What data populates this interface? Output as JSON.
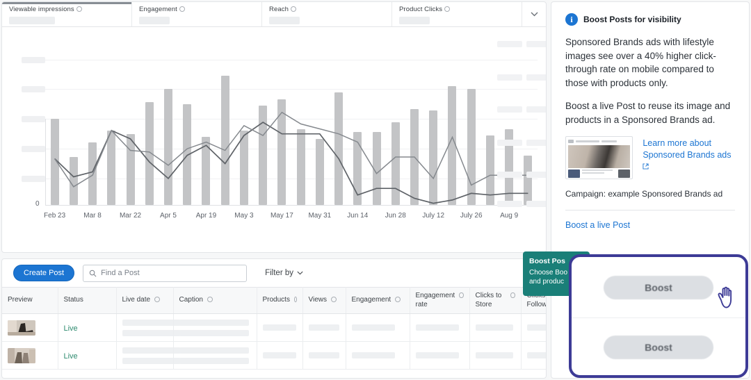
{
  "metric_tabs": [
    {
      "label": "Viewable impressions",
      "icon": "info-icon",
      "value_placeholder": "loading-skeleton"
    },
    {
      "label": "Engagement",
      "icon": "info-icon",
      "value_placeholder": "loading-skeleton"
    },
    {
      "label": "Reach",
      "icon": "info-icon",
      "value_placeholder": "loading-skeleton"
    },
    {
      "label": "Product Clicks",
      "icon": "info-icon",
      "value_placeholder": "loading-skeleton"
    }
  ],
  "tabs_caret_icon": "chevron-down-icon",
  "chart_data": {
    "type": "bar",
    "title": "",
    "xlabel": "",
    "ylabel": "",
    "ylim": [
      0,
      100
    ],
    "grid": true,
    "legend": "none",
    "y_zero_label": "0",
    "y_tick_labels": [
      "",
      "",
      "",
      "",
      ""
    ],
    "categories": [
      "Feb 23",
      "",
      "Mar 8",
      "",
      "Mar 22",
      "",
      "Apr 5",
      "",
      "Apr 19",
      "",
      "May 3",
      "",
      "May 17",
      "",
      "May 31",
      "",
      "Jun 14",
      "",
      "Jun 28",
      "",
      "July 12",
      "",
      "July 26",
      "",
      "Aug 9",
      ""
    ],
    "tick_labels": [
      "Feb 23",
      "Mar 8",
      "Mar 22",
      "Apr 5",
      "Apr 19",
      "May 3",
      "May 17",
      "May 31",
      "Jun 14",
      "Jun 28",
      "July 12",
      "July 26",
      "Aug 9"
    ],
    "values": [
      52,
      29,
      38,
      45,
      43,
      62,
      70,
      61,
      41,
      78,
      45,
      60,
      64,
      46,
      40,
      68,
      44,
      44,
      50,
      58,
      57,
      72,
      70,
      42,
      46,
      30
    ],
    "series": [
      {
        "name": "line-series-1",
        "type": "line",
        "values": [
          28,
          17,
          20,
          45,
          40,
          26,
          16,
          30,
          36,
          25,
          42,
          50,
          43,
          43,
          43,
          28,
          6,
          10,
          10,
          4,
          1,
          3,
          7,
          6,
          7,
          7
        ]
      },
      {
        "name": "line-series-2",
        "type": "line",
        "values": [
          28,
          11,
          18,
          45,
          33,
          32,
          24,
          34,
          38,
          33,
          48,
          42,
          56,
          49,
          46,
          43,
          38,
          19,
          29,
          29,
          16,
          41,
          12,
          18,
          18,
          18
        ]
      }
    ]
  },
  "toolbar": {
    "create_post_label": "Create Post",
    "search_icon": "search-icon",
    "search_placeholder": "Find a Post",
    "search_value": "",
    "filter_label": "Filter by",
    "filter_caret_icon": "chevron-down-icon"
  },
  "table": {
    "columns": [
      {
        "label": "Preview",
        "info": false
      },
      {
        "label": "Status",
        "info": false
      },
      {
        "label": "Live date",
        "info": true
      },
      {
        "label": "Caption",
        "info": true
      },
      {
        "label": "Products",
        "info": true
      },
      {
        "label": "Views",
        "info": true
      },
      {
        "label": "Engagement",
        "info": true
      },
      {
        "label": "Engagement rate",
        "info": true
      },
      {
        "label": "Clicks to Store",
        "info": true
      },
      {
        "label": "Clicks to Follow",
        "info": true
      }
    ],
    "rows": [
      {
        "preview": "post-thumbnail-1",
        "status": "Live"
      },
      {
        "preview": "post-thumbnail-2",
        "status": "Live"
      }
    ]
  },
  "right_panel": {
    "icon": "info-circle-icon",
    "title": "Boost Posts for visibility",
    "paragraph_1": "Sponsored Brands ads with lifestyle images see over a 40% higher click-through rate on mobile compared to those with products only.",
    "paragraph_2": "Boost a live Post to reuse its image and products in a Sponsored Brands ad.",
    "ad_preview_name": "sponsored-brands-ad-preview",
    "learn_more_line_1": "Learn more about",
    "learn_more_line_2": "Sponsored Brands ads",
    "external_link_icon": "external-link-icon",
    "campaign_caption": "Campaign: example Sponsored Brands ad",
    "boost_live_post_link": "Boost a live Post"
  },
  "teal_tooltip": {
    "title": "Boost Pos",
    "body_line_1": "Choose Boo",
    "body_line_2": "and produc"
  },
  "highlight": {
    "border_color": "#3d3b96",
    "boost_button_label": "Boost",
    "cursor_icon": "pointer-hand-cursor"
  },
  "colors": {
    "accent_blue": "#1c75d2",
    "status_green": "#2e8b6f",
    "tooltip_teal": "#1a7f78",
    "highlight_purple": "#3d3b96",
    "bar_gray": "#c3c4c6",
    "skeleton_gray": "#eef0f2"
  }
}
